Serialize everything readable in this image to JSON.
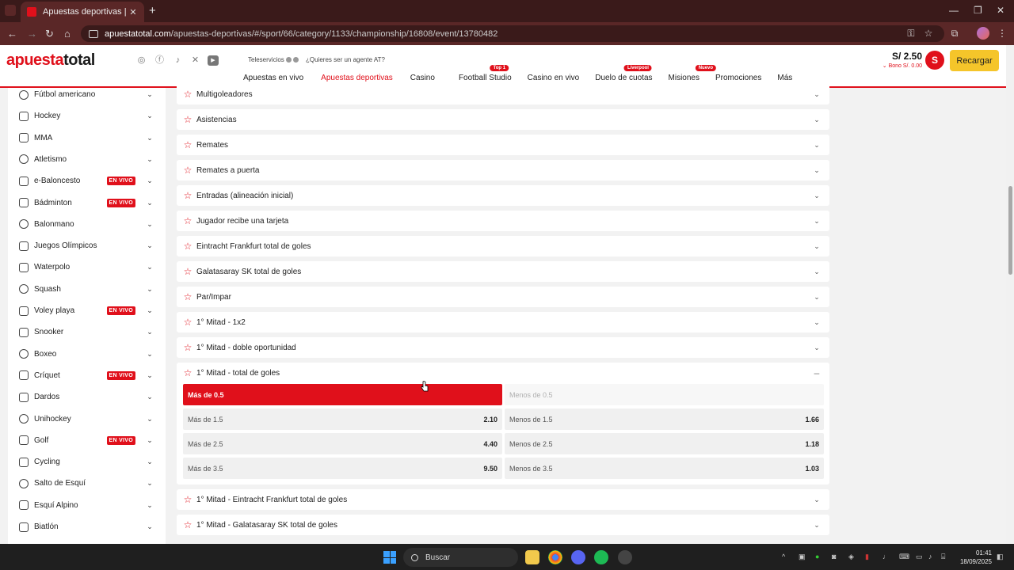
{
  "browser": {
    "tab_title": "Apuestas deportivas | Apuesta",
    "url_host": "apuestatotal.com",
    "url_path": "/apuestas-deportivas/#/sport/66/category/1133/championship/16808/event/13780482"
  },
  "header": {
    "logo_red": "apuesta",
    "logo_dark": "total",
    "teleservicios": "Teleservicios",
    "agent_link": "¿Quieres ser un agente AT?",
    "nav": [
      {
        "label": "Apuestas en vivo",
        "badge": ""
      },
      {
        "label": "Apuestas deportivas",
        "badge": "",
        "active": true
      },
      {
        "label": "Casino",
        "badge": ""
      },
      {
        "label": "Football Studio",
        "badge": "Top 1"
      },
      {
        "label": "Casino en vivo",
        "badge": ""
      },
      {
        "label": "Duelo de cuotas",
        "badge": "Liverpool"
      },
      {
        "label": "Misiones",
        "badge": "Nuevo"
      },
      {
        "label": "Promociones",
        "badge": ""
      },
      {
        "label": "Más",
        "badge": ""
      }
    ],
    "balance": "S/ 2.50",
    "bono": "⌄ Bono S/. 0.00",
    "avatar_letter": "S",
    "recargar": "Recargar"
  },
  "sidebar": {
    "live_label": "EN VIVO",
    "sports": [
      {
        "label": "Fútbol americano",
        "live": false,
        "icon": "football-icon"
      },
      {
        "label": "Hockey",
        "live": false,
        "icon": "hockey-icon"
      },
      {
        "label": "MMA",
        "live": false,
        "icon": "mma-icon"
      },
      {
        "label": "Atletismo",
        "live": false,
        "icon": "athletics-icon"
      },
      {
        "label": "e-Baloncesto",
        "live": true,
        "icon": "ebasketball-icon"
      },
      {
        "label": "Bádminton",
        "live": true,
        "icon": "badminton-icon"
      },
      {
        "label": "Balonmano",
        "live": false,
        "icon": "handball-icon"
      },
      {
        "label": "Juegos Olímpicos",
        "live": false,
        "icon": "olympics-icon"
      },
      {
        "label": "Waterpolo",
        "live": false,
        "icon": "waterpolo-icon"
      },
      {
        "label": "Squash",
        "live": false,
        "icon": "squash-icon"
      },
      {
        "label": "Voley playa",
        "live": true,
        "icon": "beach-volley-icon"
      },
      {
        "label": "Snooker",
        "live": false,
        "icon": "snooker-icon"
      },
      {
        "label": "Boxeo",
        "live": false,
        "icon": "boxing-icon"
      },
      {
        "label": "Críquet",
        "live": true,
        "icon": "cricket-icon"
      },
      {
        "label": "Dardos",
        "live": false,
        "icon": "darts-icon"
      },
      {
        "label": "Unihockey",
        "live": false,
        "icon": "unihockey-icon"
      },
      {
        "label": "Golf",
        "live": true,
        "icon": "golf-icon"
      },
      {
        "label": "Cycling",
        "live": false,
        "icon": "cycling-icon"
      },
      {
        "label": "Salto de Esquí",
        "live": false,
        "icon": "ski-jump-icon"
      },
      {
        "label": "Esquí Alpino",
        "live": false,
        "icon": "alpine-ski-icon"
      },
      {
        "label": "Biatlón",
        "live": false,
        "icon": "biathlon-icon"
      }
    ]
  },
  "markets": [
    "Multigoleadores",
    "Asistencias",
    "Remates",
    "Remates a puerta",
    "Entradas (alineación inicial)",
    "Jugador recibe una tarjeta",
    "Eintracht Frankfurt total de goles",
    "Galatasaray SK total de goles",
    "Par/Impar",
    "1° Mitad - 1x2",
    "1° Mitad - doble oportunidad"
  ],
  "expanded_market": {
    "title": "1° Mitad - total de goles",
    "rows": [
      {
        "over_label": "Más de 0.5",
        "over_val": "",
        "under_label": "Menos de 0.5",
        "under_val": ""
      },
      {
        "over_label": "Más de 1.5",
        "over_val": "2.10",
        "under_label": "Menos de 1.5",
        "under_val": "1.66"
      },
      {
        "over_label": "Más de 2.5",
        "over_val": "4.40",
        "under_label": "Menos de 2.5",
        "under_val": "1.18"
      },
      {
        "over_label": "Más de 3.5",
        "over_val": "9.50",
        "under_label": "Menos de 3.5",
        "under_val": "1.03"
      }
    ]
  },
  "markets_after": [
    "1° Mitad - Eintracht Frankfurt total de goles",
    "1° Mitad - Galatasaray SK total de goles"
  ],
  "taskbar": {
    "search": "Buscar",
    "time": "01:41",
    "date": "18/09/2025"
  },
  "colors": {
    "brand": "#e0101b",
    "accent": "#f5c52a"
  }
}
